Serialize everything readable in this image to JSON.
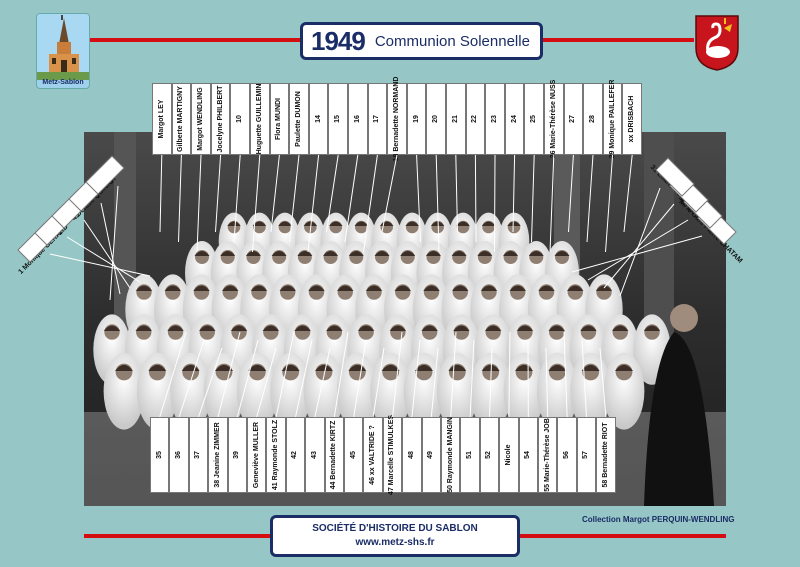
{
  "header": {
    "year": "1949",
    "title": "Communion Solennelle",
    "village_caption": "Metz-Sablon"
  },
  "top_labels": [
    "Margot LEY",
    "Gilberte MARTIGNY",
    "Margot WENDLING",
    "Jocelyne PHILBERT",
    "10",
    "Huguette GUILLEMIN",
    "Flora MUNDI",
    "Paulette DUMON",
    "14",
    "15",
    "16",
    "17",
    "18 Bernadette NORMAND",
    "19",
    "20",
    "21",
    "22",
    "23",
    "24",
    "25",
    "26 Marie-Thérèse NUSS",
    "27",
    "28",
    "29 Monique PAILLEFER",
    "xx DRISBACH"
  ],
  "left_diagonal_labels": [
    "5",
    "4 Denise QUINIOT",
    "3",
    "2",
    "1 Monique GERARD"
  ],
  "right_diagonal_labels": [
    "31 Eliane TOBI",
    "32",
    "33 xx SIMON",
    "M. le Curé Pierre CHATAM"
  ],
  "bottom_labels": [
    "35",
    "36",
    "37",
    "38 Jeanine ZIMMER",
    "39",
    "Geneviève MULLER",
    "41 Raymonde STOLZ",
    "42",
    "43",
    "44 Bernadette KIRTZ",
    "45",
    "46 xx VALTRIDE ?",
    "47 Marcelle STIMULKES",
    "48",
    "49",
    "50 Raymonde MANGIN",
    "51",
    "52",
    "Nicole",
    "54",
    "55 Marie-Thérèse JOB",
    "56",
    "57",
    "58 Bernadette RIOT"
  ],
  "footer": {
    "society": "SOCIÉTÉ D'HISTOIRE DU SABLON",
    "website": "www.metz-shs.fr"
  },
  "credit": "Collection Margot PERQUIN-WENDLING",
  "colors": {
    "background": "#97c6c6",
    "accent_red": "#d40d12",
    "navy": "#1a2d66"
  }
}
